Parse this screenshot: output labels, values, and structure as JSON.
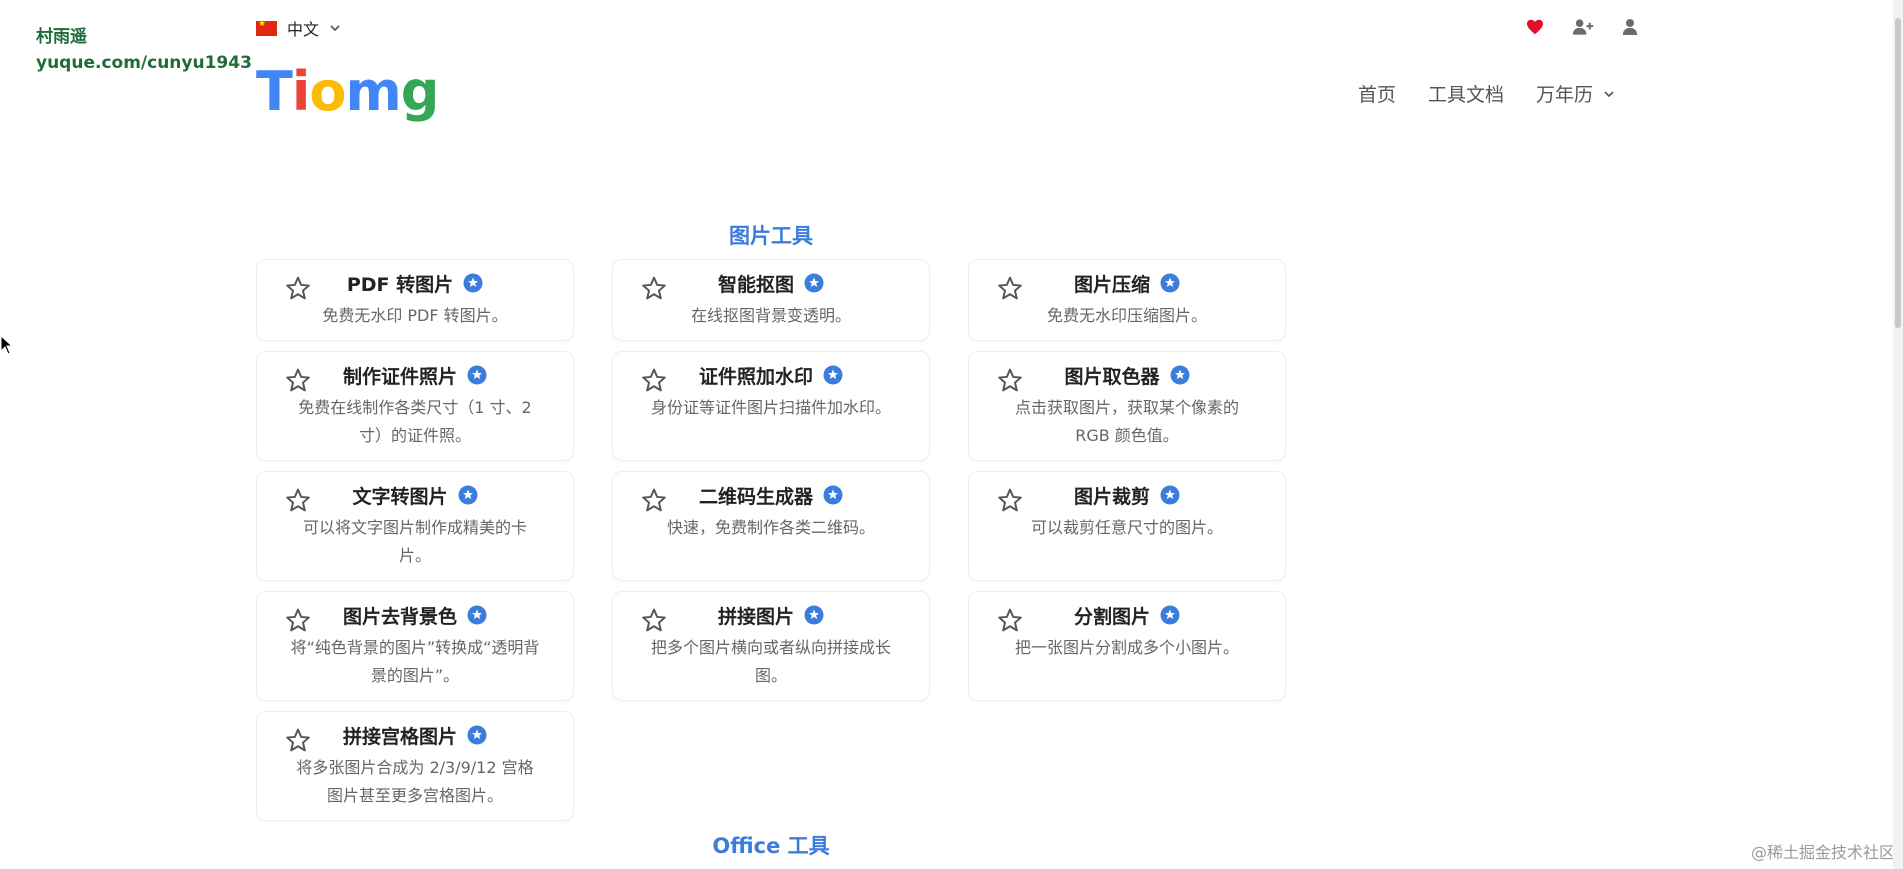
{
  "watermark": {
    "author": "村雨遥",
    "url": "yuque.com/cunyu1943",
    "bottom": "@稀土掘金技术社区"
  },
  "header": {
    "language": "中文",
    "logo_letters": [
      {
        "ch": "T",
        "color": "#4285F4"
      },
      {
        "ch": "i",
        "color": "#EA4335"
      },
      {
        "ch": "o",
        "color": "#FBBC05"
      },
      {
        "ch": "m",
        "color": "#4285F4"
      },
      {
        "ch": "g",
        "color": "#34A853"
      }
    ],
    "icons": [
      "heart-icon",
      "add-user-icon",
      "user-icon"
    ],
    "nav": {
      "home": "首页",
      "docs": "工具文档",
      "calendar": "万年历"
    }
  },
  "sections": {
    "image_tools": "图片工具",
    "office_tools": "Office 工具"
  },
  "cards": [
    {
      "title": "PDF 转图片",
      "desc": "免费无水印 PDF 转图片。"
    },
    {
      "title": "智能抠图",
      "desc": "在线抠图背景变透明。"
    },
    {
      "title": "图片压缩",
      "desc": "免费无水印压缩图片。"
    },
    {
      "title": "制作证件照片",
      "desc": "免费在线制作各类尺寸（1 寸、2 寸）的证件照。"
    },
    {
      "title": "证件照加水印",
      "desc": "身份证等证件图片扫描件加水印。"
    },
    {
      "title": "图片取色器",
      "desc": "点击获取图片，获取某个像素的 RGB 颜色值。"
    },
    {
      "title": "文字转图片",
      "desc": "可以将文字图片制作成精美的卡片。"
    },
    {
      "title": "二维码生成器",
      "desc": "快速，免费制作各类二维码。"
    },
    {
      "title": "图片裁剪",
      "desc": "可以裁剪任意尺寸的图片。"
    },
    {
      "title": "图片去背景色",
      "desc": "将“纯色背景的图片”转换成“透明背景的图片”。"
    },
    {
      "title": "拼接图片",
      "desc": "把多个图片横向或者纵向拼接成长图。"
    },
    {
      "title": "分割图片",
      "desc": "把一张图片分割成多个小图片。"
    },
    {
      "title": "拼接宫格图片",
      "desc": "将多张图片合成为 2/3/9/12 宫格图片甚至更多宫格图片。"
    }
  ],
  "colors": {
    "accent": "#3b7ddd",
    "heart": "#e0102a"
  }
}
